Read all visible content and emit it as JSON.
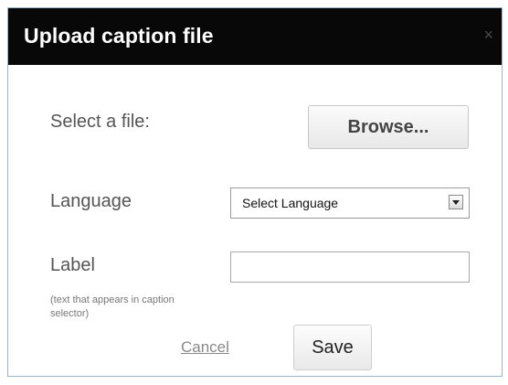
{
  "dialog": {
    "title": "Upload caption file",
    "close_glyph": "×",
    "close_icon": "close-icon"
  },
  "file": {
    "label": "Select a file:",
    "browse_label": "Browse..."
  },
  "language": {
    "label": "Language",
    "selected": "Select Language",
    "dropdown_icon": "chevron-down-icon"
  },
  "caption_label": {
    "label": "Label",
    "hint": "(text that appears in caption selector)",
    "value": ""
  },
  "actions": {
    "cancel_label": "Cancel",
    "save_label": "Save"
  },
  "colors": {
    "titlebar": "#080808",
    "title_text": "#ffffff",
    "label_text": "#555555",
    "link": "#888888"
  }
}
